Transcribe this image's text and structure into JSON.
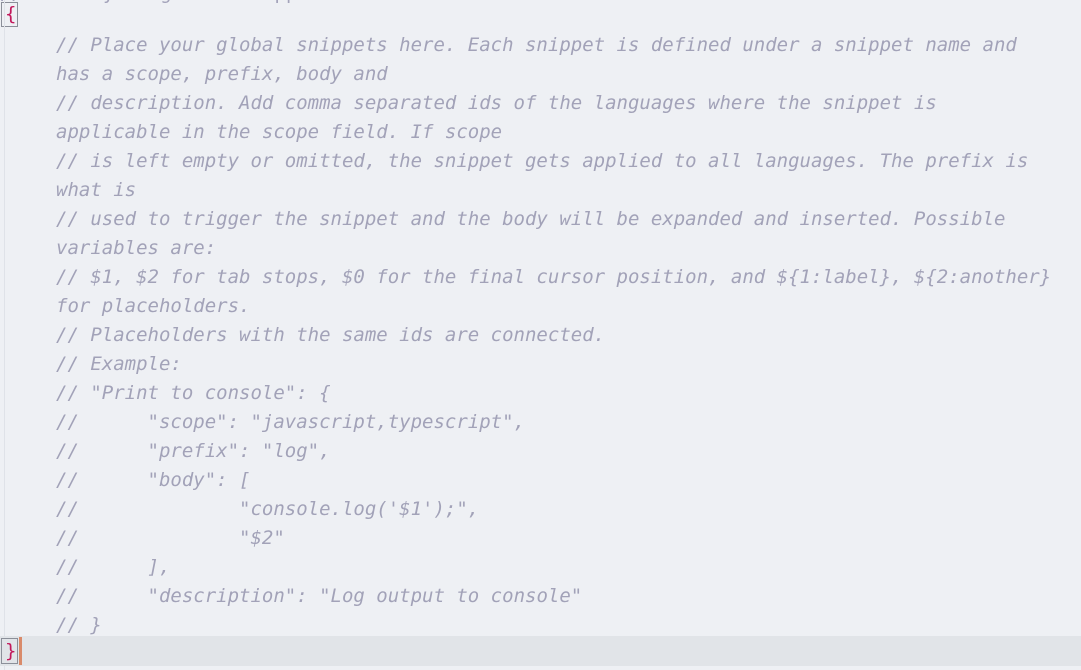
{
  "editor": {
    "language": "json",
    "background_color": "#eef0f4",
    "comment_color": "#a2a2b8",
    "brace_color": "#c2185b",
    "current_line_color": "#e1e4e8",
    "caret_color": "#d98a6a",
    "bracket_match_border": "#8b8f99",
    "clipped_top_line": "// Place your global snippets here."
  },
  "code": {
    "open_brace": "{",
    "close_brace": "}",
    "comment_lines": [
      "// Place your global snippets here. Each snippet is defined under a snippet name and has a scope, prefix, body and",
      "// description. Add comma separated ids of the languages where the snippet is applicable in the scope field. If scope",
      "// is left empty or omitted, the snippet gets applied to all languages. The prefix is what is",
      "// used to trigger the snippet and the body will be expanded and inserted. Possible variables are:",
      "// $1, $2 for tab stops, $0 for the final cursor position, and ${1:label}, ${2:another} for placeholders.",
      "// Placeholders with the same ids are connected.",
      "// Example:",
      "// \"Print to console\": {",
      "// \t\"scope\": \"javascript,typescript\",",
      "// \t\"prefix\": \"log\",",
      "// \t\"body\": [",
      "// \t\t\"console.log('$1');\",",
      "// \t\t\"$2\"",
      "// \t],",
      "// \t\"description\": \"Log output to console\"",
      "// }"
    ]
  }
}
